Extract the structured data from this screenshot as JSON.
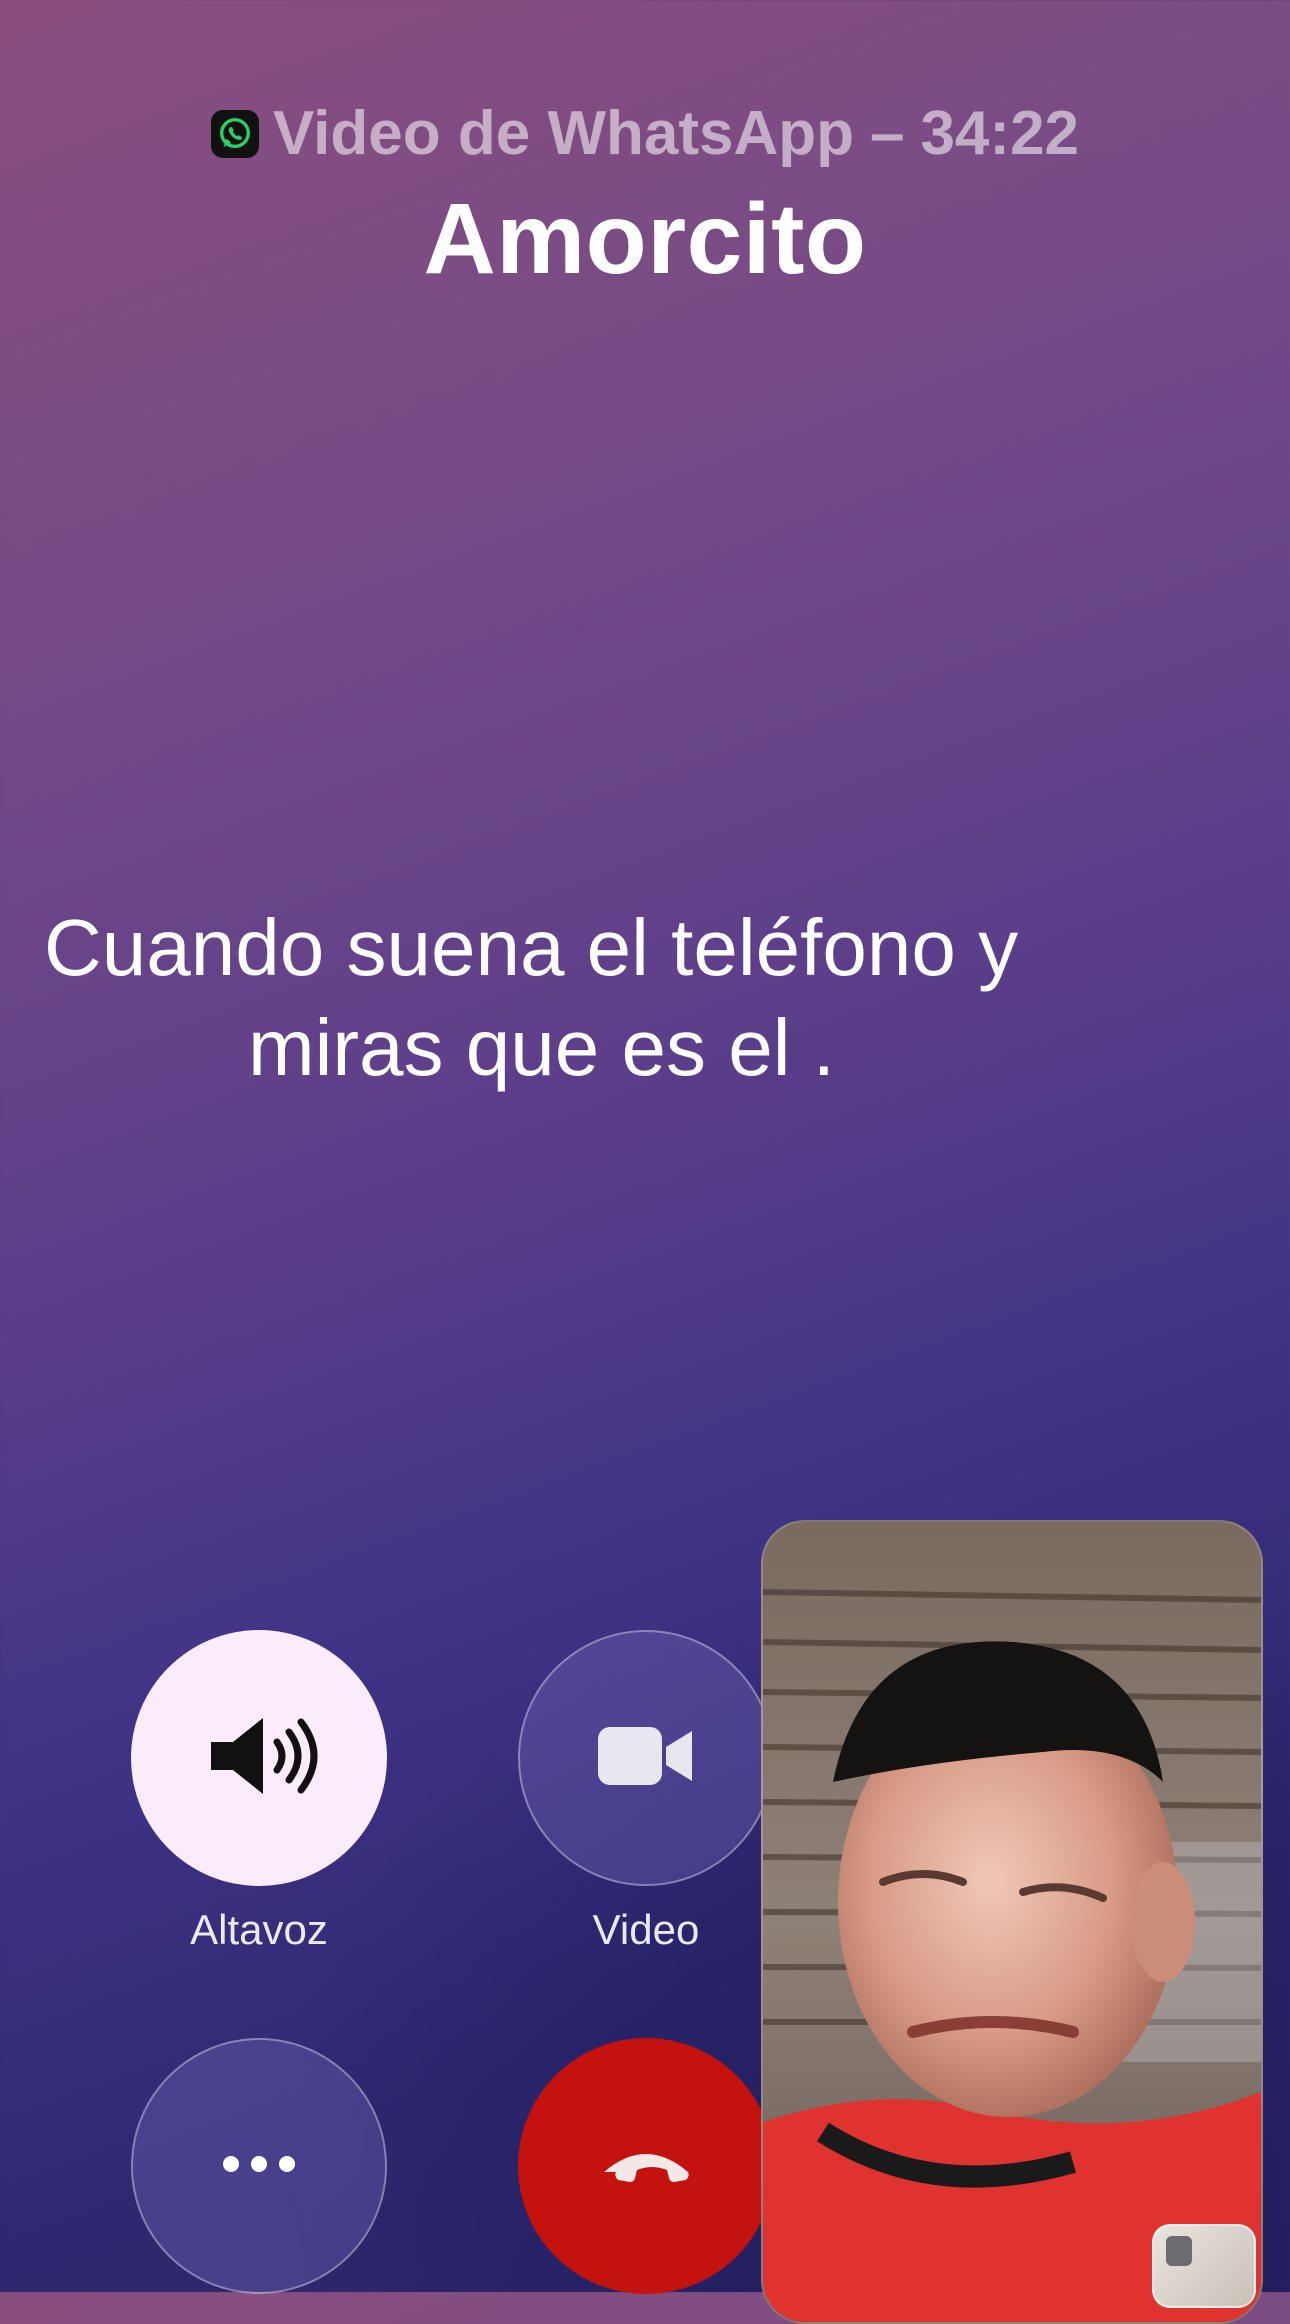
{
  "call": {
    "app_label": "Video de WhatsApp",
    "separator": "–",
    "duration": "34:22",
    "contact_name": "Amorcito"
  },
  "caption": {
    "line1": "Cuando suena el teléfono y",
    "line2": "miras que es el ."
  },
  "controls": {
    "speaker_label": "Altavoz",
    "video_label": "Video"
  },
  "colors": {
    "end_call": "#c4120f",
    "speaker_active_bg": "#fbecfb",
    "whatsapp_green": "#25d366"
  },
  "icons": {
    "app": "whatsapp-icon",
    "speaker": "speaker-icon",
    "video": "video-camera-icon",
    "more": "more-dots-icon",
    "end_call": "phone-hangup-icon"
  }
}
